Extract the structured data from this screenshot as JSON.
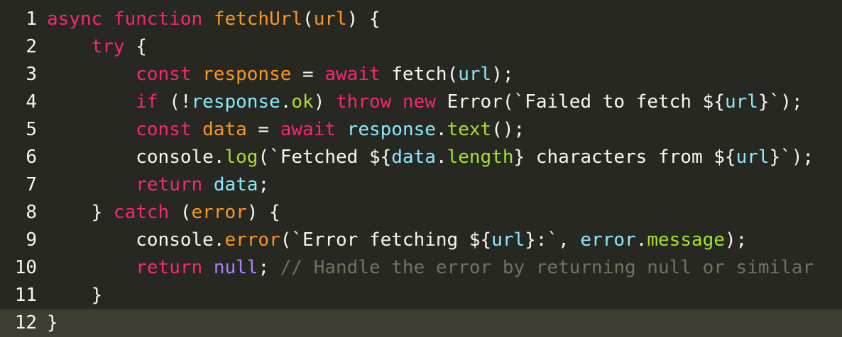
{
  "editor": {
    "lines": [
      {
        "number": "1",
        "tokens": [
          {
            "text": "async ",
            "type": "kw"
          },
          {
            "text": "function ",
            "type": "kw"
          },
          {
            "text": "fetchUrl",
            "type": "fn"
          },
          {
            "text": "(",
            "type": "pun"
          },
          {
            "text": "url",
            "type": "var"
          },
          {
            "text": ") {",
            "type": "pun"
          }
        ]
      },
      {
        "number": "2",
        "tokens": [
          {
            "text": "    ",
            "type": "pun"
          },
          {
            "text": "try",
            "type": "kw"
          },
          {
            "text": " {",
            "type": "pun"
          }
        ]
      },
      {
        "number": "3",
        "tokens": [
          {
            "text": "        ",
            "type": "pun"
          },
          {
            "text": "const ",
            "type": "kw"
          },
          {
            "text": "response",
            "type": "var"
          },
          {
            "text": " = ",
            "type": "pun"
          },
          {
            "text": "await ",
            "type": "kw"
          },
          {
            "text": "fetch",
            "type": "id"
          },
          {
            "text": "(",
            "type": "pun"
          },
          {
            "text": "url",
            "type": "obj"
          },
          {
            "text": ");",
            "type": "pun"
          }
        ]
      },
      {
        "number": "4",
        "tokens": [
          {
            "text": "        ",
            "type": "pun"
          },
          {
            "text": "if ",
            "type": "kw"
          },
          {
            "text": "(!",
            "type": "pun"
          },
          {
            "text": "response",
            "type": "obj"
          },
          {
            "text": ".",
            "type": "pun"
          },
          {
            "text": "ok",
            "type": "prop"
          },
          {
            "text": ") ",
            "type": "pun"
          },
          {
            "text": "throw ",
            "type": "kw"
          },
          {
            "text": "new ",
            "type": "kw"
          },
          {
            "text": "Error",
            "type": "id"
          },
          {
            "text": "(`Failed to fetch ${",
            "type": "str"
          },
          {
            "text": "url",
            "type": "obj"
          },
          {
            "text": "}`);",
            "type": "str"
          }
        ]
      },
      {
        "number": "5",
        "tokens": [
          {
            "text": "        ",
            "type": "pun"
          },
          {
            "text": "const ",
            "type": "kw"
          },
          {
            "text": "data",
            "type": "var"
          },
          {
            "text": " = ",
            "type": "pun"
          },
          {
            "text": "await ",
            "type": "kw"
          },
          {
            "text": "response",
            "type": "obj"
          },
          {
            "text": ".",
            "type": "pun"
          },
          {
            "text": "text",
            "type": "prop"
          },
          {
            "text": "();",
            "type": "pun"
          }
        ]
      },
      {
        "number": "6",
        "tokens": [
          {
            "text": "        ",
            "type": "pun"
          },
          {
            "text": "console",
            "type": "id"
          },
          {
            "text": ".",
            "type": "pun"
          },
          {
            "text": "log",
            "type": "prop"
          },
          {
            "text": "(`Fetched ${",
            "type": "str"
          },
          {
            "text": "data",
            "type": "obj"
          },
          {
            "text": ".",
            "type": "pun"
          },
          {
            "text": "length",
            "type": "prop"
          },
          {
            "text": "} characters from ${",
            "type": "str"
          },
          {
            "text": "url",
            "type": "obj"
          },
          {
            "text": "}`);",
            "type": "str"
          }
        ]
      },
      {
        "number": "7",
        "tokens": [
          {
            "text": "        ",
            "type": "pun"
          },
          {
            "text": "return ",
            "type": "kw"
          },
          {
            "text": "data",
            "type": "obj"
          },
          {
            "text": ";",
            "type": "pun"
          }
        ]
      },
      {
        "number": "8",
        "tokens": [
          {
            "text": "    } ",
            "type": "pun"
          },
          {
            "text": "catch ",
            "type": "kw"
          },
          {
            "text": "(",
            "type": "pun"
          },
          {
            "text": "error",
            "type": "var"
          },
          {
            "text": ") {",
            "type": "pun"
          }
        ]
      },
      {
        "number": "9",
        "tokens": [
          {
            "text": "        ",
            "type": "pun"
          },
          {
            "text": "console",
            "type": "id"
          },
          {
            "text": ".",
            "type": "pun"
          },
          {
            "text": "error",
            "type": "var"
          },
          {
            "text": "(`Error fetching ${",
            "type": "str"
          },
          {
            "text": "url",
            "type": "obj"
          },
          {
            "text": "}:`, ",
            "type": "str"
          },
          {
            "text": "error",
            "type": "obj"
          },
          {
            "text": ".",
            "type": "pun"
          },
          {
            "text": "message",
            "type": "prop"
          },
          {
            "text": ");",
            "type": "pun"
          }
        ]
      },
      {
        "number": "10",
        "tokens": [
          {
            "text": "        ",
            "type": "pun"
          },
          {
            "text": "return ",
            "type": "kw"
          },
          {
            "text": "null",
            "type": "lit"
          },
          {
            "text": "; ",
            "type": "pun"
          },
          {
            "text": "// Handle the error by returning null or similar",
            "type": "com"
          }
        ]
      },
      {
        "number": "11",
        "tokens": [
          {
            "text": "    }",
            "type": "pun"
          }
        ]
      },
      {
        "number": "12",
        "active": true,
        "tokens": [
          {
            "text": "}",
            "type": "pun"
          }
        ]
      }
    ]
  },
  "colors": {
    "background": "#272822",
    "active_line": "#3e3d32",
    "keyword": "#f92672",
    "function_name": "#fd971f",
    "parameter": "#fd971f",
    "identifier": "#f8f8f2",
    "property": "#a6e22e",
    "object": "#8be9fd",
    "literal": "#ae81ff",
    "comment": "#75715e"
  }
}
